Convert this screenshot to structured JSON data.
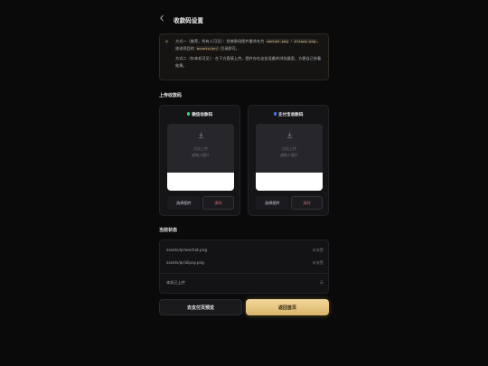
{
  "header": {
    "back_icon": "chevron-left-icon",
    "title": "收款码设置"
  },
  "notice": {
    "icon": "sparkle-icon",
    "method1_a": "方式一（推荐，所有人可见）：把收款码图片重命名为 ",
    "code_wechat": "wechat.png",
    "sep": " / ",
    "code_alipay": "alipay.png",
    "method1_b": "，放进项目的 ",
    "code_dir": "assets/qr/",
    "method1_c": " 目录即可。",
    "method2": "方式二（仅本机可见）：在下方直接上传，图片存在这台设备的浏览器里，方便自己先看效果。"
  },
  "upload_title": "上传收款码",
  "cards": [
    {
      "title": "微信收款码",
      "dot_color": "#3fcf7a",
      "hint1": "点击上传",
      "hint2": "或拖入图片",
      "choose": "选择图片",
      "clear": "清除"
    },
    {
      "title": "支付宝收款码",
      "dot_color": "#3b7be8",
      "hint1": "点击上传",
      "hint2": "或拖入图片",
      "choose": "选择图片",
      "clear": "清除"
    }
  ],
  "status_title": "当前状态",
  "status": {
    "rows": [
      {
        "label": "assets/qr/wechat.png",
        "value": "未放置"
      },
      {
        "label": "assets/qr/alipay.png",
        "value": "未放置"
      }
    ],
    "local": {
      "label": "本机已上传",
      "value": "无"
    }
  },
  "buttons": {
    "pay_preview": "去支付页预览",
    "home": "返回首页"
  },
  "colors": {
    "accent": "#d9b46a",
    "danger": "#c86a6a"
  }
}
